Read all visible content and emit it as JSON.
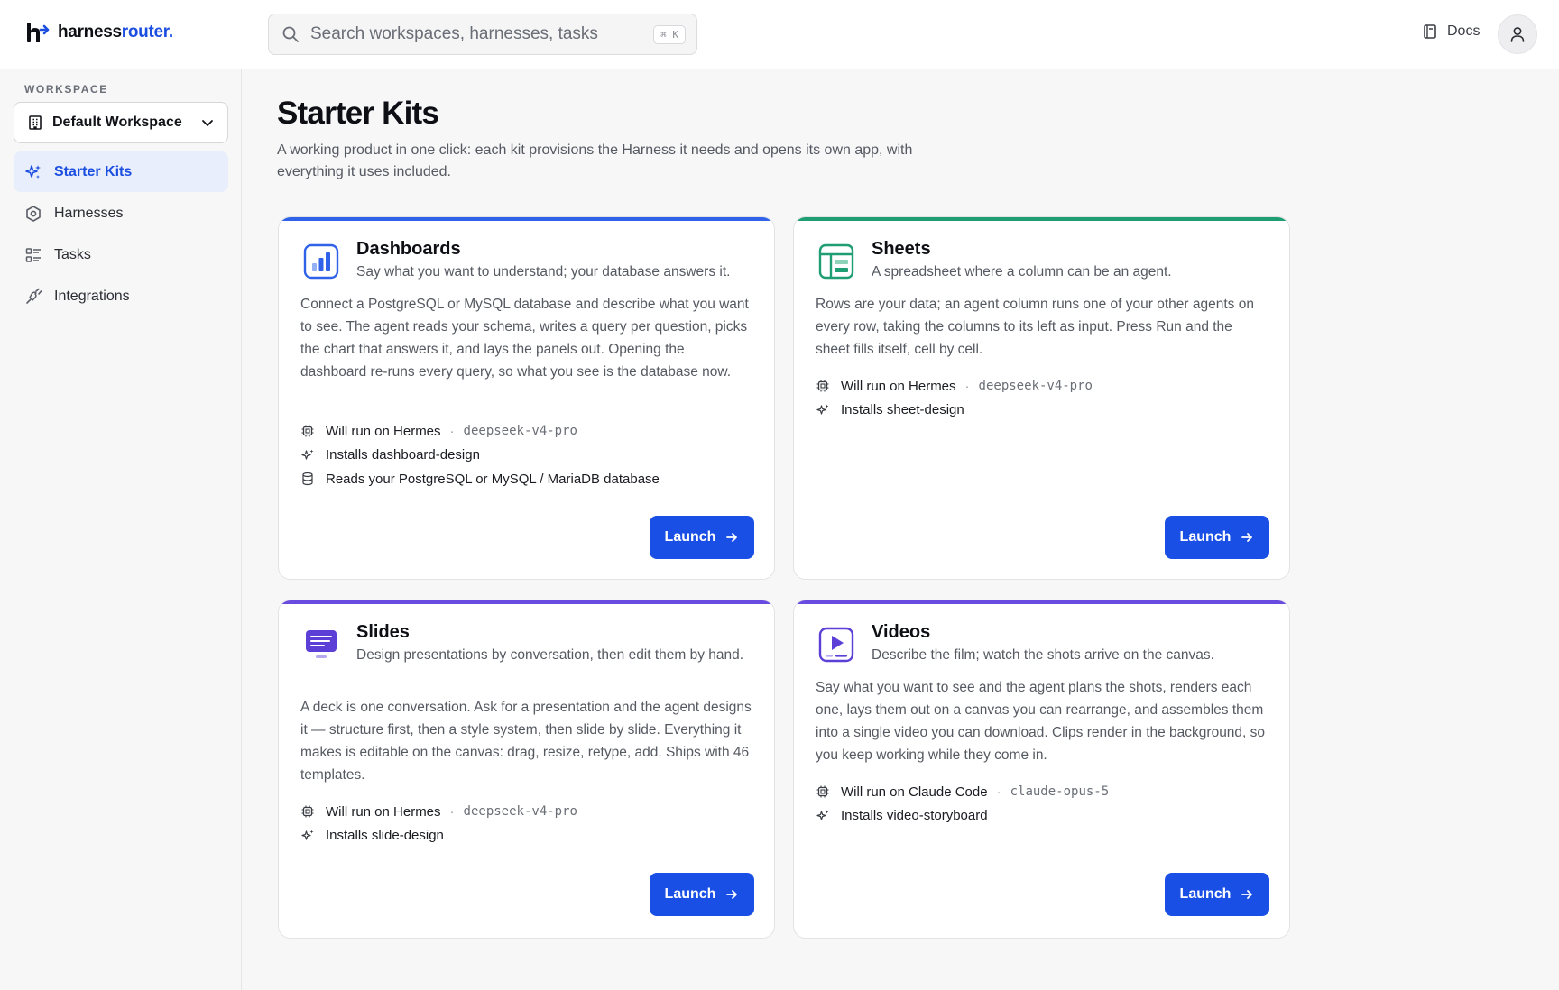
{
  "brand": {
    "name_main": "harness",
    "name_accent": "router."
  },
  "search": {
    "placeholder": "Search workspaces, harnesses, tasks",
    "shortcut": "⌘ K"
  },
  "header": {
    "docs_label": "Docs"
  },
  "sidebar": {
    "workspace_label": "WORKSPACE",
    "workspace_name": "Default Workspace",
    "items": [
      {
        "label": "Starter Kits",
        "icon": "sparkles-icon",
        "active": true
      },
      {
        "label": "Harnesses",
        "icon": "hexagon-icon",
        "active": false
      },
      {
        "label": "Tasks",
        "icon": "list-icon",
        "active": false
      },
      {
        "label": "Integrations",
        "icon": "plug-icon",
        "active": false
      }
    ]
  },
  "main": {
    "title": "Starter Kits",
    "subtitle": "A working product in one click: each kit provisions the Harness it needs and opens its own app, with everything it uses included."
  },
  "kits": [
    {
      "title": "Dashboards",
      "accent": "#2f62e8",
      "icon": "bar-chart-icon",
      "tagline": "Say what you want to understand; your database answers it.",
      "description": "Connect a PostgreSQL or MySQL database and describe what you want to see. The agent reads your schema, writes a query per question, picks the chart that answers it, and lays the panels out. Opening the dashboard re-runs every query, so what you see is the database now.",
      "runs_on": "Will run on Hermes",
      "model": "deepseek-v4-pro",
      "installs": "Installs dashboard-design",
      "extra": "Reads your PostgreSQL or MySQL / MariaDB database",
      "launch_label": "Launch"
    },
    {
      "title": "Sheets",
      "accent": "#1f9e74",
      "icon": "spreadsheet-icon",
      "tagline": "A spreadsheet where a column can be an agent.",
      "description": "Rows are your data; an agent column runs one of your other agents on every row, taking the columns to its left as input. Press Run and the sheet fills itself, cell by cell.",
      "runs_on": "Will run on Hermes",
      "model": "deepseek-v4-pro",
      "installs": "Installs sheet-design",
      "launch_label": "Launch"
    },
    {
      "title": "Slides",
      "accent": "#6a4be0",
      "icon": "presentation-icon",
      "tagline": "Design presentations by conversation, then edit them by hand.",
      "description": "A deck is one conversation. Ask for a presentation and the agent designs it — structure first, then a style system, then slide by slide. Everything it makes is editable on the canvas: drag, resize, retype, add. Ships with 46 templates.",
      "runs_on": "Will run on Hermes",
      "model": "deepseek-v4-pro",
      "installs": "Installs slide-design",
      "launch_label": "Launch"
    },
    {
      "title": "Videos",
      "accent": "#6a4be0",
      "icon": "video-icon",
      "tagline": "Describe the film; watch the shots arrive on the canvas.",
      "description": "Say what you want to see and the agent plans the shots, renders each one, lays them out on a canvas you can rearrange, and assembles them into a single video you can download. Clips render in the background, so you keep working while they come in.",
      "runs_on": "Will run on Claude Code",
      "model": "claude-opus-5",
      "installs": "Installs video-storyboard",
      "launch_label": "Launch"
    }
  ],
  "colors": {
    "primary": "#1a4fe6",
    "active_nav_bg": "#e8eefc"
  }
}
